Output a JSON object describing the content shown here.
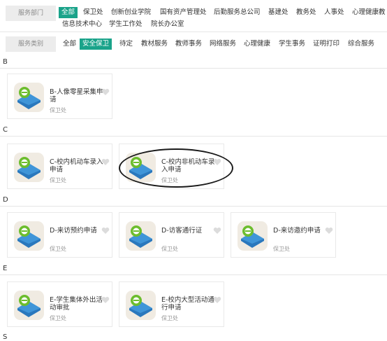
{
  "filters": {
    "department": {
      "label": "服务部门",
      "row1": [
        "全部",
        "保卫处",
        "创新创业学院",
        "国有资产管理处",
        "后勤服务总公司",
        "基建处",
        "教务处",
        "人事处",
        "心理健康教"
      ],
      "row2": [
        "信息技术中心",
        "学生工作处",
        "院长办公室"
      ],
      "active": "全部"
    },
    "category": {
      "label": "服务类别",
      "items": [
        "全部",
        "安全保卫",
        "待定",
        "教材服务",
        "教师事务",
        "网络服务",
        "心理健康",
        "学生事务",
        "证明打印",
        "综合服务"
      ],
      "active": "安全保卫"
    }
  },
  "sections": [
    {
      "letter": "B",
      "cards": [
        {
          "title": "B-人像零星采集申请",
          "org": "保卫处"
        }
      ]
    },
    {
      "letter": "C",
      "cards": [
        {
          "title": "C-校内机动车录入申请",
          "org": "保卫处"
        },
        {
          "title": "C-校内非机动车录入申请",
          "org": "保卫处"
        }
      ]
    },
    {
      "letter": "D",
      "cards": [
        {
          "title": "D-来访预约申请",
          "org": "保卫处"
        },
        {
          "title": "D-访客通行证",
          "org": "保卫处"
        },
        {
          "title": "D-来访邀约申请",
          "org": "保卫处"
        }
      ]
    },
    {
      "letter": "E",
      "cards": [
        {
          "title": "E-学生集体外出活动审批",
          "org": "保卫处"
        },
        {
          "title": "E-校内大型活动通行申请",
          "org": "保卫处"
        }
      ]
    },
    {
      "letter": "S",
      "cards": []
    }
  ],
  "colors": {
    "accent": "#1aa38a",
    "annotation": "#1a1a1a"
  },
  "icons": {
    "service": "app-service-icon",
    "favorite": "heart-icon"
  }
}
